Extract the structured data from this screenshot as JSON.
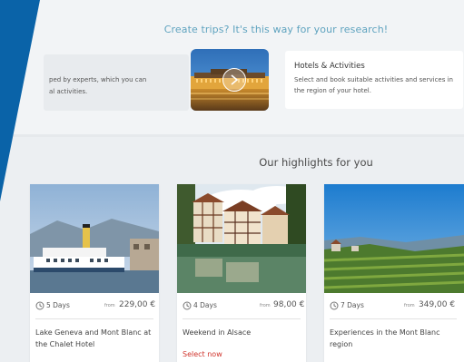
{
  "research": {
    "headline": "Create trips? It's this way for your research!",
    "left_card": {
      "line1": "ped by experts, which you can",
      "line2": "al activities."
    },
    "hotels": {
      "title": "Hotels & Activities",
      "description": "Select and book suitable activities and services in the region of your hotel."
    }
  },
  "highlights": {
    "title": "Our highlights for you",
    "from_label": "from",
    "tours": [
      {
        "duration": "5 Days",
        "price": "229,00 €",
        "name": "Lake Geneva and Mont Blanc at the Chalet Hotel",
        "cta": ""
      },
      {
        "duration": "4 Days",
        "price": "98,00 €",
        "name": "Weekend in Alsace",
        "cta": "Select now"
      },
      {
        "duration": "7 Days",
        "price": "349,00 €",
        "name": "Experiences in the Mont Blanc region",
        "cta": ""
      }
    ]
  },
  "colors": {
    "accent_blue": "#0a63a8",
    "headline_teal": "#5fa3bf",
    "cta_red": "#d0342c"
  },
  "icons": {
    "carousel_next": "chevron-right-icon",
    "duration": "clock-icon"
  }
}
